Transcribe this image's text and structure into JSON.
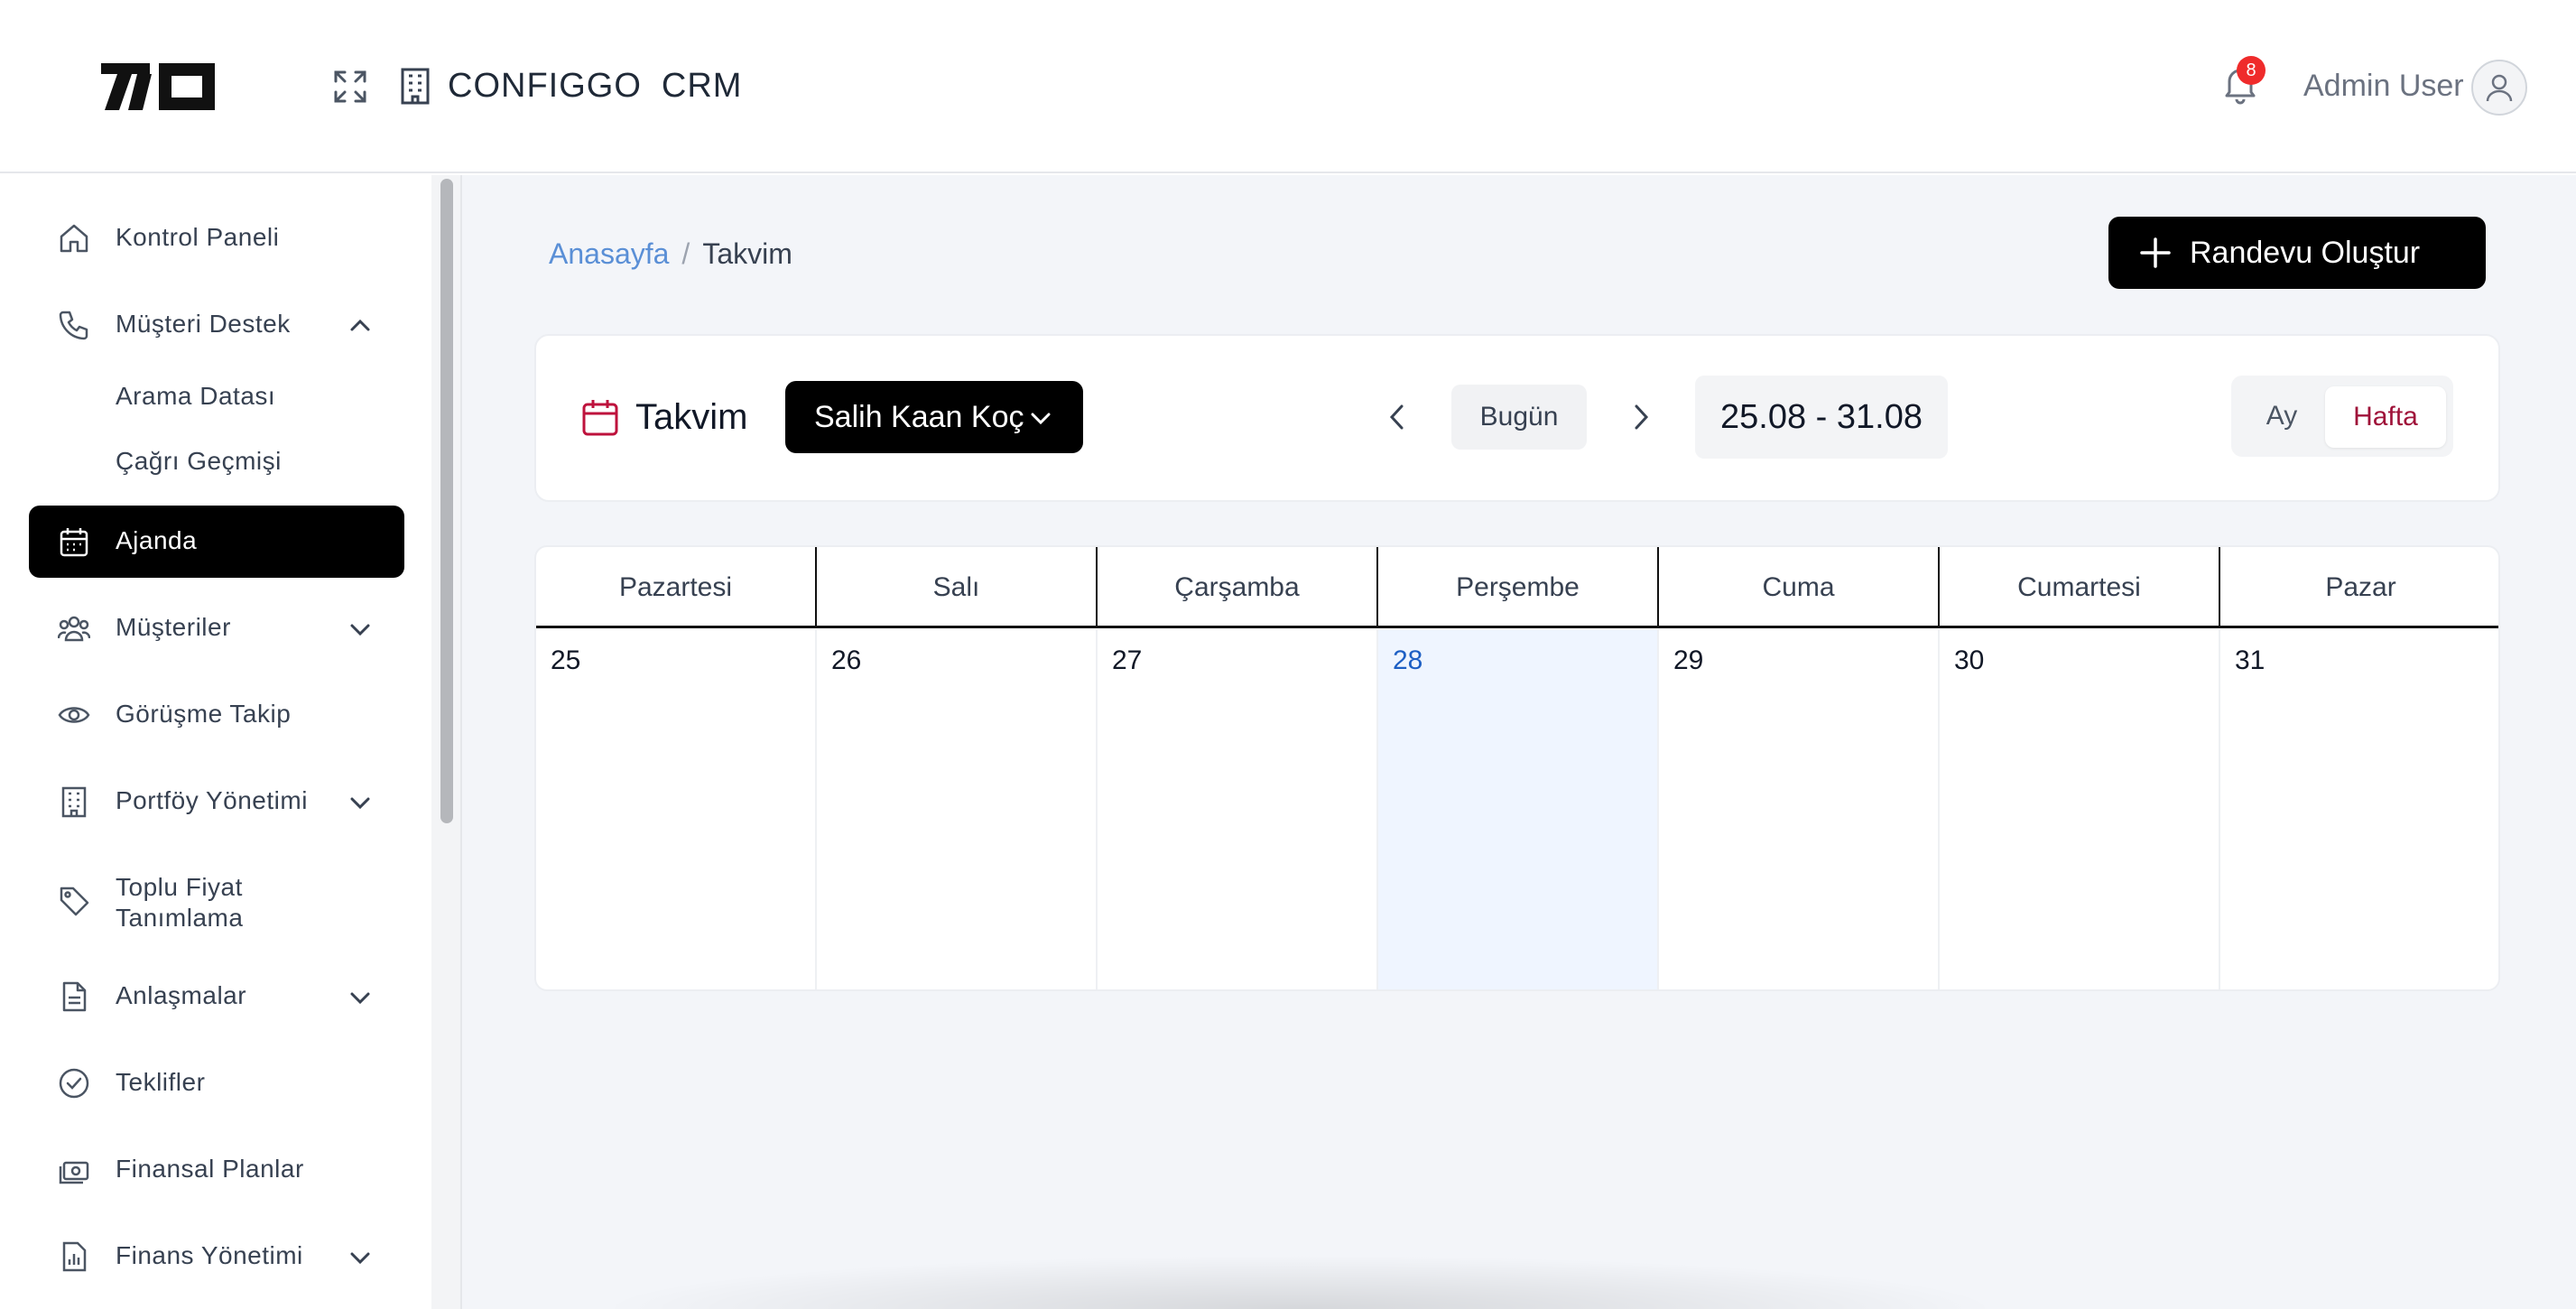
{
  "header": {
    "app_name_part1": "CONFIGGO",
    "app_name_part2": "CRM",
    "notification_count": "8",
    "user_name": "Admin User"
  },
  "sidebar": {
    "items": [
      {
        "label": "Kontrol Paneli",
        "icon": "home-icon"
      },
      {
        "label": "Müşteri Destek",
        "icon": "phone-icon",
        "expanded": true
      },
      {
        "label": "Arama Datası"
      },
      {
        "label": "Çağrı Geçmişi"
      },
      {
        "label": "Ajanda",
        "icon": "calendar-icon",
        "active": true
      },
      {
        "label": "Müşteriler",
        "icon": "users-icon"
      },
      {
        "label": "Görüşme Takip",
        "icon": "eye-icon"
      },
      {
        "label": "Portföy Yönetimi",
        "icon": "building-icon"
      },
      {
        "label": "Toplu Fiyat",
        "label2": "Tanımlama",
        "icon": "tag-icon"
      },
      {
        "label": "Anlaşmalar",
        "icon": "document-icon"
      },
      {
        "label": "Teklifler",
        "icon": "check-circle-icon"
      },
      {
        "label": "Finansal Planlar",
        "icon": "money-icon"
      },
      {
        "label": "Finans Yönetimi",
        "icon": "bar-chart-icon"
      }
    ]
  },
  "breadcrumb": {
    "home": "Anasayfa",
    "separator": "/",
    "current": "Takvim"
  },
  "actions": {
    "create_label": "Randevu Oluştur"
  },
  "calendar": {
    "title": "Takvim",
    "selected_person": "Salih Kaan Koç",
    "today_label": "Bugün",
    "range": "25.08 - 31.08",
    "view_month": "Ay",
    "view_week": "Hafta",
    "active_view": "Hafta",
    "weekdays": [
      "Pazartesi",
      "Salı",
      "Çarşamba",
      "Perşembe",
      "Cuma",
      "Cumartesi",
      "Pazar"
    ],
    "days": [
      "25",
      "26",
      "27",
      "28",
      "29",
      "30",
      "31"
    ],
    "today_day": "28"
  },
  "colors": {
    "accent": "#000000",
    "today_bg": "#eff5ff",
    "today_text": "#1d5fc4",
    "link": "#5a8fd6",
    "active_view_text": "#9f1239",
    "badge": "#ef2b2b",
    "calendar_icon": "#be123c"
  }
}
